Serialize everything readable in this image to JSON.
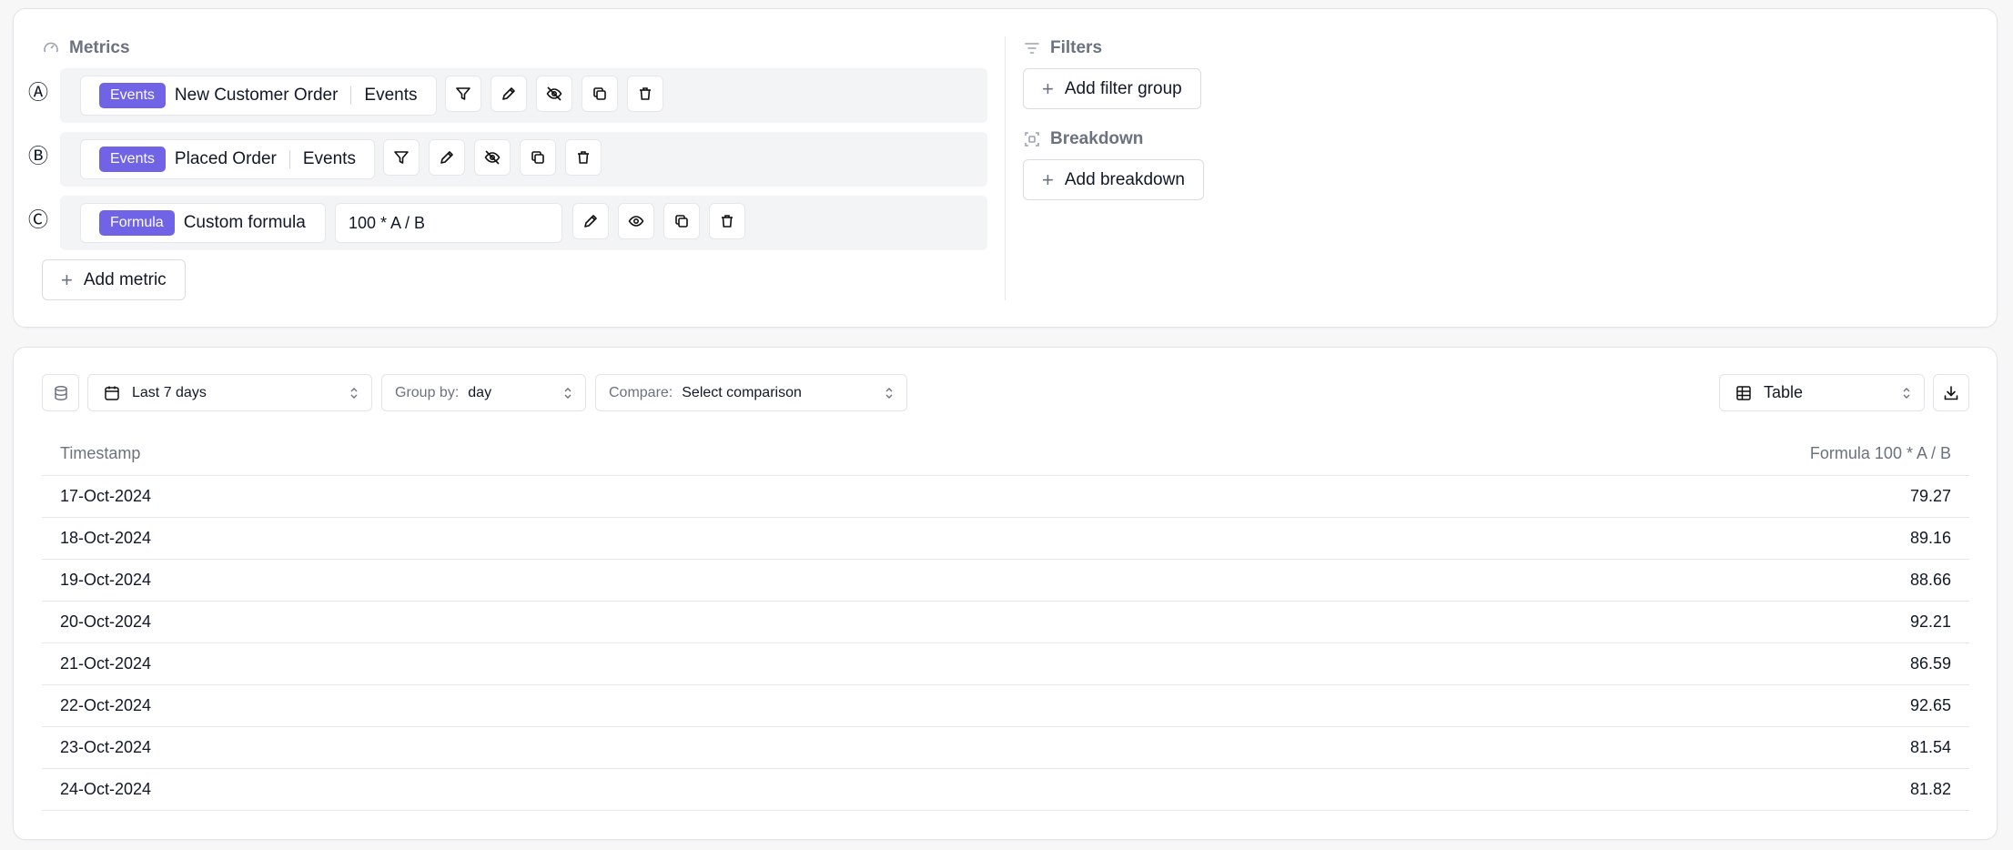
{
  "metrics_panel": {
    "title": "Metrics",
    "rows": [
      {
        "letter": "Ⓐ",
        "badge": "Events",
        "name": "New Customer Order",
        "type": "Events",
        "hidden": true
      },
      {
        "letter": "Ⓑ",
        "badge": "Events",
        "name": "Placed Order",
        "type": "Events",
        "hidden": true
      },
      {
        "letter": "Ⓒ",
        "badge": "Formula",
        "name": "Custom formula",
        "formula": "100 * A / B",
        "hidden": false
      }
    ],
    "add_metric_label": "Add metric"
  },
  "filters_panel": {
    "title": "Filters",
    "add_filter_label": "Add filter group",
    "breakdown_title": "Breakdown",
    "add_breakdown_label": "Add breakdown"
  },
  "toolbar": {
    "date_range": "Last 7 days",
    "group_by_label": "Group by:",
    "group_by_value": "day",
    "compare_label": "Compare:",
    "compare_value": "Select comparison",
    "view_mode": "Table"
  },
  "table": {
    "columns": [
      "Timestamp",
      "Formula 100 * A / B"
    ],
    "rows": [
      [
        "17-Oct-2024",
        "79.27"
      ],
      [
        "18-Oct-2024",
        "89.16"
      ],
      [
        "19-Oct-2024",
        "88.66"
      ],
      [
        "20-Oct-2024",
        "92.21"
      ],
      [
        "21-Oct-2024",
        "86.59"
      ],
      [
        "22-Oct-2024",
        "92.65"
      ],
      [
        "23-Oct-2024",
        "81.54"
      ],
      [
        "24-Oct-2024",
        "81.82"
      ]
    ]
  },
  "colors": {
    "accent": "#7063e6",
    "border": "#e5e7eb",
    "muted_text": "#6b7280"
  }
}
